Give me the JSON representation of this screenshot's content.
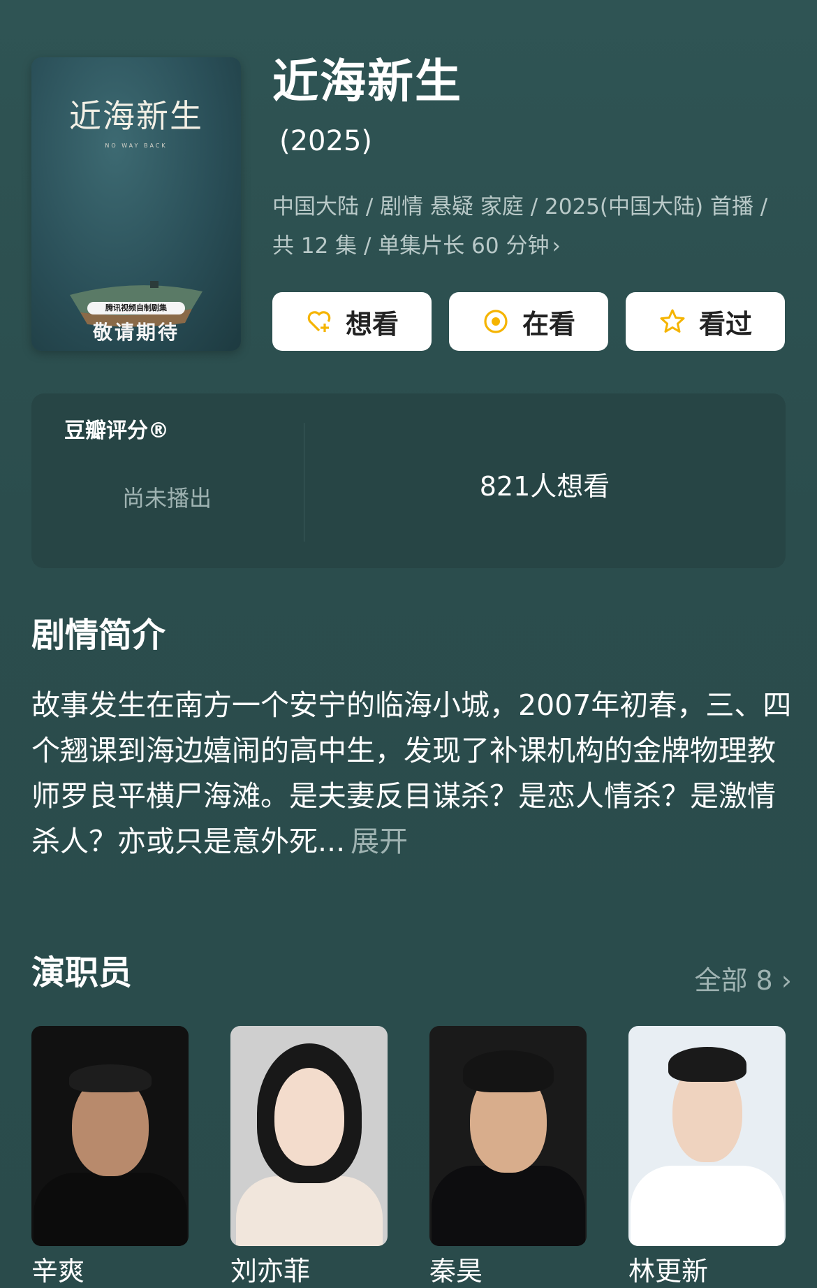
{
  "poster": {
    "title": "近海新生",
    "subtitle": "NO WAY BACK",
    "tag": "腾讯视频自制剧集",
    "await": "敬请期待"
  },
  "show": {
    "title": "近海新生",
    "year": "(2025)",
    "meta": "中国大陆 / 剧情 悬疑 家庭 / 2025(中国大陆) 首播 / 共 12 集 / 单集片长 60 分钟",
    "meta_chevron": "›"
  },
  "actions": {
    "want": "想看",
    "watching": "在看",
    "watched": "看过",
    "accent": "#f5b400"
  },
  "rating": {
    "label": "豆瓣评分®",
    "status": "尚未播出",
    "want_count": "821人想看"
  },
  "synopsis": {
    "title": "剧情简介",
    "text": "故事发生在南方一个安宁的临海小城，2007年初春，三、四个翘课到海边嬉闹的高中生，发现了补课机构的金牌物理教师罗良平横尸海滩。是夫妻反目谋杀？是恋人情杀？是激情杀人？亦或只是意外死...",
    "expand": "展开"
  },
  "cast": {
    "title": "演职员",
    "all": "全部 8 ›",
    "members": [
      {
        "name": "辛爽"
      },
      {
        "name": "刘亦菲"
      },
      {
        "name": "秦昊"
      },
      {
        "name": "林更新"
      }
    ]
  }
}
